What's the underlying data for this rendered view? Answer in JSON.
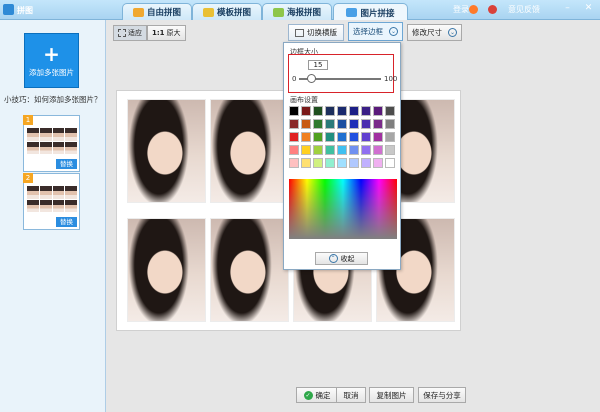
{
  "window": {
    "title": "拼图"
  },
  "tabs": [
    {
      "label": "自由拼图"
    },
    {
      "label": "模板拼图"
    },
    {
      "label": "海报拼图"
    },
    {
      "label": "图片拼接"
    }
  ],
  "header_right": {
    "login": "登录",
    "feedback": "意见反馈",
    "minimize": "–",
    "close": "✕"
  },
  "sidebar": {
    "add_button": "添加多张图片",
    "tip": "小技巧：如何添加多张图片？",
    "thumbs": [
      {
        "num": "1",
        "replace": "替换"
      },
      {
        "num": "2",
        "replace": "替换"
      }
    ]
  },
  "toolbar": {
    "fit_label": "适应",
    "ratio_text": "1:1",
    "original_label": "原大",
    "switch_label": "切换横版",
    "border_label": "选择边框",
    "size_label": "修改尺寸"
  },
  "border_popup": {
    "border_size_label": "边框大小",
    "value": "15",
    "min": "0",
    "max": "100",
    "slider_fraction": 0.15,
    "canvas_settings_label": "画布设置",
    "collapse_label": "收起",
    "swatches": [
      "#000000",
      "#7a1a1a",
      "#1f4f1f",
      "#1d2f5c",
      "#1a2a6e",
      "#1c1f86",
      "#3a1f86",
      "#5a1a7a",
      "#4d4d4d",
      "#8b2a2a",
      "#c85a12",
      "#2f7a2f",
      "#2a7a7a",
      "#1c4fa0",
      "#2030b8",
      "#4a2fb0",
      "#7a2a8a",
      "#7f7f7f",
      "#e02020",
      "#f08020",
      "#50a020",
      "#209080",
      "#2070d0",
      "#2050e0",
      "#6040d0",
      "#a030a0",
      "#a6a6a6",
      "#ff8080",
      "#ffd020",
      "#a0d040",
      "#40c0a0",
      "#40c0f0",
      "#7090f0",
      "#9070f0",
      "#d070d0",
      "#c8c8c8",
      "#ffc0c0",
      "#ffe070",
      "#d0f080",
      "#90f0d0",
      "#a0e0ff",
      "#b0c8ff",
      "#c0b0ff",
      "#f0b0f0",
      "#ffffff"
    ]
  },
  "bottom_bar": {
    "confirm": "确定",
    "cancel": "取消",
    "copy": "复制图片",
    "save_share": "保存与分享"
  }
}
